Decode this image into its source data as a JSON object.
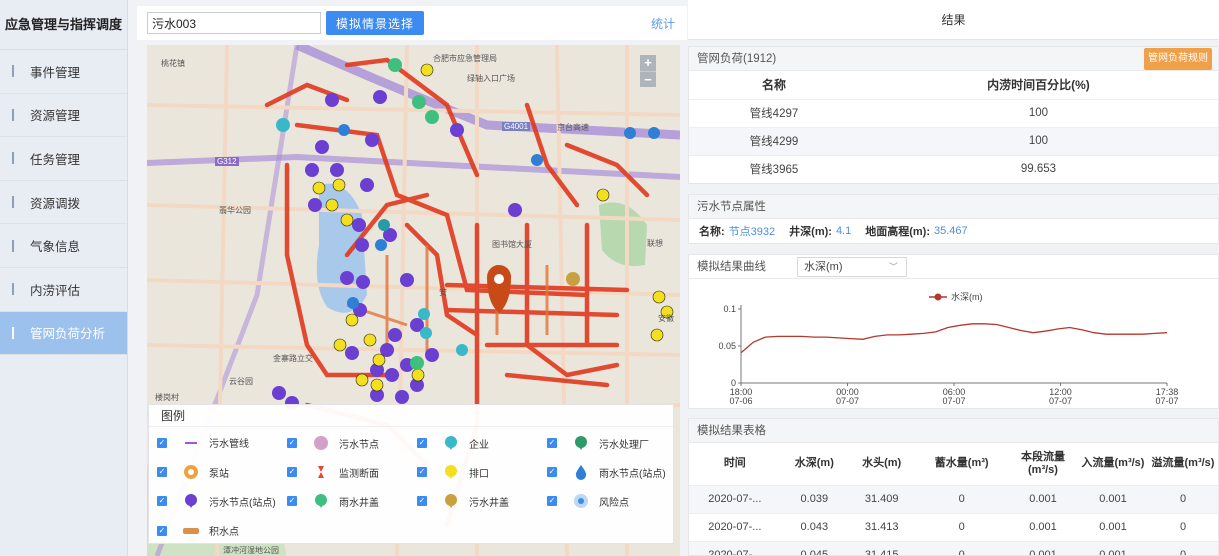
{
  "sidebar": {
    "title": "应急管理与指挥调度",
    "items": [
      {
        "label": "事件管理"
      },
      {
        "label": "资源管理"
      },
      {
        "label": "任务管理"
      },
      {
        "label": "资源调拨"
      },
      {
        "label": "气象信息"
      },
      {
        "label": "内涝评估"
      },
      {
        "label": "管网负荷分析"
      }
    ],
    "active_index": 6
  },
  "toolbar": {
    "scenario_value": "污水003",
    "sim_button": "模拟情景选择",
    "stats_link": "统计"
  },
  "map": {
    "zoom_in": "+",
    "zoom_out": "−",
    "labels": {
      "l1": "桃花镇",
      "l2": "合肥市应急管理局",
      "l3": "绿轴入口广场",
      "l4": "G4001",
      "l5": "京台高速",
      "l6": "G312",
      "l7": "翡华公园",
      "l8": "图书馆大厦",
      "l9": "联想",
      "l10": "安徽",
      "l11": "金寨路立交",
      "l12": "云谷园",
      "l13": "楼岗村",
      "l14": "潭冲河湿地公园",
      "l15": "安"
    }
  },
  "legend": {
    "title": "图例",
    "items": [
      {
        "label": "污水管线",
        "icon": "sewage-pipe-icon"
      },
      {
        "label": "污水节点",
        "icon": "sewage-node-icon"
      },
      {
        "label": "企业",
        "icon": "enterprise-icon"
      },
      {
        "label": "污水处理厂",
        "icon": "treatment-plant-icon"
      },
      {
        "label": "泵站",
        "icon": "pump-station-icon"
      },
      {
        "label": "监测断面",
        "icon": "monitor-section-icon"
      },
      {
        "label": "排口",
        "icon": "outfall-icon"
      },
      {
        "label": "雨水节点(站点)",
        "icon": "rain-node-station-icon"
      },
      {
        "label": "污水节点(站点)",
        "icon": "sewage-node-station-icon"
      },
      {
        "label": "雨水井盖",
        "icon": "rain-manhole-icon"
      },
      {
        "label": "污水井盖",
        "icon": "sewage-manhole-icon"
      },
      {
        "label": "风险点",
        "icon": "risk-point-icon"
      },
      {
        "label": "积水点",
        "icon": "ponding-point-icon"
      }
    ]
  },
  "right": {
    "header": "结果",
    "load": {
      "title": "管网负荷(1912)",
      "rule_button": "管网负荷规则",
      "columns": [
        "名称",
        "内涝时间百分比(%)"
      ],
      "rows": [
        [
          "管线4297",
          "100"
        ],
        [
          "管线4299",
          "100"
        ],
        [
          "管线3965",
          "99.653"
        ]
      ]
    },
    "node": {
      "title": "污水节点属性",
      "name_label": "名称:",
      "name_value": "节点3932",
      "depth_label": "井深(m):",
      "depth_value": "4.1",
      "elev_label": "地面高程(m):",
      "elev_value": "35.467"
    },
    "curve": {
      "title": "模拟结果曲线",
      "select_value": "水深(m)"
    },
    "results": {
      "title": "模拟结果表格",
      "columns": [
        "时间",
        "水深(m)",
        "水头(m)",
        "蓄水量(m³)",
        "本段流量(m³/s)",
        "入流量(m³/s)",
        "溢流量(m³/s)"
      ],
      "rows": [
        [
          "2020-07-...",
          "0.039",
          "31.409",
          "0",
          "0.001",
          "0.001",
          "0"
        ],
        [
          "2020-07-...",
          "0.043",
          "31.413",
          "0",
          "0.001",
          "0.001",
          "0"
        ],
        [
          "2020-07-...",
          "0.045",
          "31.415",
          "0",
          "0.001",
          "0.001",
          "0"
        ]
      ]
    }
  },
  "chart_data": {
    "type": "line",
    "legend_position": "top",
    "series": [
      {
        "name": "水深(m)",
        "color": "#b5372e"
      }
    ],
    "x_ticks": [
      [
        "18:00",
        "07-06"
      ],
      [
        "00:00",
        "07-07"
      ],
      [
        "06:00",
        "07-07"
      ],
      [
        "12:00",
        "07-07"
      ],
      [
        "17:38",
        "07-07"
      ]
    ],
    "y_ticks": [
      "0.1",
      "0.05",
      "0"
    ],
    "ylim": [
      0,
      0.1
    ],
    "values": [
      0.041,
      0.055,
      0.062,
      0.063,
      0.063,
      0.063,
      0.062,
      0.062,
      0.061,
      0.06,
      0.059,
      0.063,
      0.065,
      0.065,
      0.066,
      0.067,
      0.069,
      0.075,
      0.078,
      0.08,
      0.08,
      0.079,
      0.075,
      0.071,
      0.068,
      0.07,
      0.073,
      0.075,
      0.072,
      0.068,
      0.066,
      0.066,
      0.066,
      0.066,
      0.067,
      0.068
    ]
  },
  "colors": {
    "accent": "#3c8bf0",
    "active_nav": "#9cc1ec",
    "rule_button": "#f0a048",
    "link": "#4b8fe0",
    "pipe_red": "#e03a1e",
    "marker_purple": "#6a3fd1",
    "marker_yellow": "#f3df1d",
    "marker_blue": "#2f7fd6",
    "marker_teal": "#38b8c8",
    "marker_green": "#3fbf7f"
  }
}
